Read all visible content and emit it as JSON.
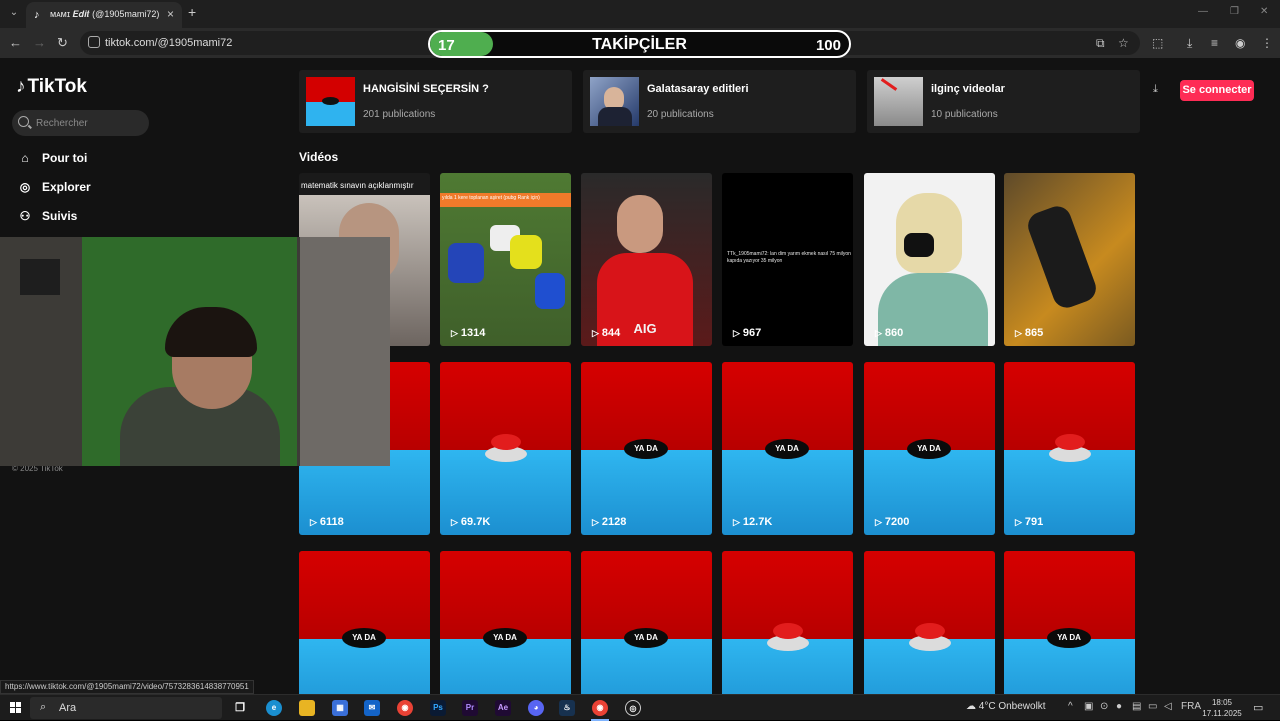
{
  "browser": {
    "tab_title": "ᴍᴀᴍɪ 𝑬𝒅𝒊𝒕 (@1905mami72) | T",
    "url": "tiktok.com/@1905mami72",
    "status_url": "https://www.tiktok.com/@1905mami72/video/7573283614838770951"
  },
  "overlay": {
    "start": "17",
    "label": "TAKİPÇİLER",
    "goal": "100",
    "progress_percent": 15,
    "fill_color": "#4fae4f"
  },
  "sidebar": {
    "logo": "TikTok",
    "search_placeholder": "Rechercher",
    "items": [
      {
        "label": "Pour toi",
        "icon": "home-icon"
      },
      {
        "label": "Explorer",
        "icon": "compass-icon"
      },
      {
        "label": "Suivis",
        "icon": "user-icon"
      }
    ],
    "copyright": "© 2025 TikTok"
  },
  "header": {
    "connect_label": "Se connecter",
    "accent": "#fe2c55"
  },
  "playlists": [
    {
      "title": "HANGİSİNİ SEÇERSİN ?",
      "count": "201 publications"
    },
    {
      "title": "Galatasaray editleri",
      "count": "20 publications"
    },
    {
      "title": "ilginç videolar",
      "count": "10 publications"
    }
  ],
  "videos_title": "Vidéos",
  "videos": [
    {
      "views": "",
      "caption": "matematik sınavın açıklanmıştır",
      "style": "photo"
    },
    {
      "views": "1314",
      "caption": "yılda 1 kere toplanan aşiret (pubg Rank için)",
      "style": "cars"
    },
    {
      "views": "844",
      "caption": "AIG",
      "style": "football"
    },
    {
      "views": "967",
      "caption": "TTk_1905mami72: lan dim yarım ekmek nasıl 75 milyon kapıda yazıyor 35 milyon",
      "style": "text"
    },
    {
      "views": "860",
      "caption": "",
      "style": "anime"
    },
    {
      "views": "865",
      "caption": "",
      "style": "car"
    },
    {
      "views": "6118",
      "caption": "",
      "style": "yada"
    },
    {
      "views": "69.7K",
      "caption": "",
      "style": "button"
    },
    {
      "views": "2128",
      "caption": "YA DA",
      "style": "yada"
    },
    {
      "views": "12.7K",
      "caption": "YA DA",
      "style": "yada"
    },
    {
      "views": "7200",
      "caption": "YA DA",
      "style": "yada"
    },
    {
      "views": "791",
      "caption": "",
      "style": "button"
    },
    {
      "views": "",
      "caption": "YA DA",
      "style": "yada"
    },
    {
      "views": "",
      "caption": "YA DA",
      "style": "yada"
    },
    {
      "views": "",
      "caption": "YA DA",
      "style": "yada"
    },
    {
      "views": "",
      "caption": "",
      "style": "button"
    },
    {
      "views": "",
      "caption": "",
      "style": "button"
    },
    {
      "views": "",
      "caption": "YA DA",
      "style": "yada"
    }
  ],
  "taskbar": {
    "search_label": "Ara",
    "weather": "4°C  Onbewolkt",
    "lang": "FRA",
    "time": "18:05",
    "date": "17.11.2025",
    "apps": [
      "Ps",
      "Pr",
      "Ae"
    ]
  }
}
